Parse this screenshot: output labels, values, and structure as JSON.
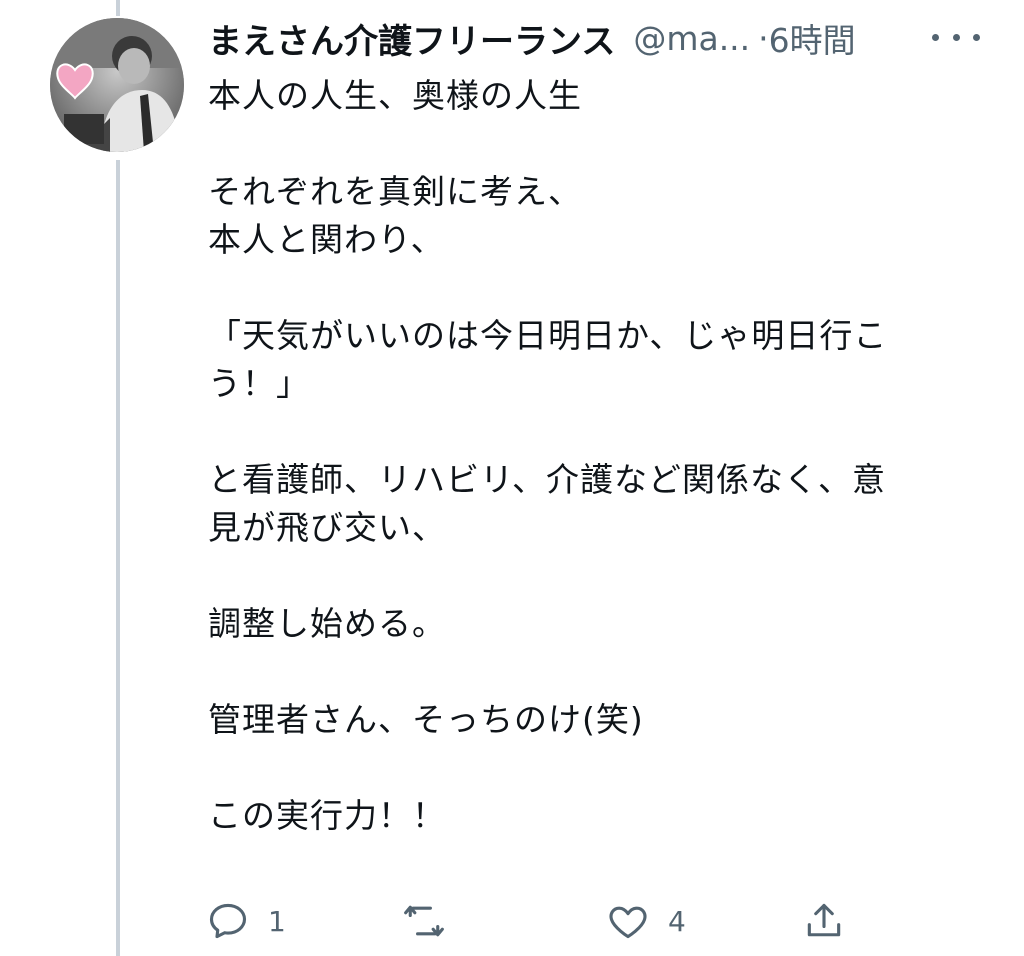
{
  "tweet": {
    "author_name": "まえさん介護フリーランス",
    "handle": "@ma...",
    "separator": "·",
    "time": "6時間",
    "paragraphs": [
      [
        "本人の人生、奥様の人生"
      ],
      [
        "それぞれを真剣に考え、",
        "本人と関わり、"
      ],
      [
        "「天気がいいのは今日明日か、じゃ明日行こ",
        "う！」"
      ],
      [
        "と看護師、リハビリ、介護など関係なく、意",
        "見が飛び交い、"
      ],
      [
        "調整し始める。"
      ],
      [
        "管理者さん、そっちのけ(笑)"
      ],
      [
        "この実行力！！"
      ]
    ]
  },
  "actions": {
    "reply": {
      "icon": "reply-icon",
      "count": "1"
    },
    "retweet": {
      "icon": "retweet-icon",
      "count": ""
    },
    "like": {
      "icon": "heart-icon",
      "count": "4"
    },
    "share": {
      "icon": "share-icon",
      "count": ""
    }
  },
  "colors": {
    "text": "#0f1419",
    "secondary": "#536471",
    "thread_line": "#c9d1d9"
  }
}
